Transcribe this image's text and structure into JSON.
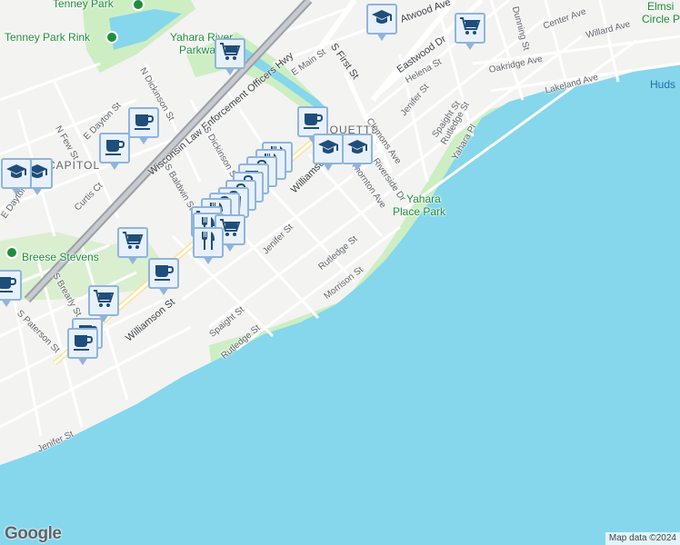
{
  "map": {
    "attribution": "Map data ©2024",
    "logo": "Google",
    "colors": {
      "water": "#86d6ec",
      "park": "#cdeec3",
      "land": "#f3f3f1",
      "highway": "#9aa0a6",
      "marker_fill": "#e8f1fb",
      "marker_border": "#8fb4dc",
      "marker_icon": "#1f4e7a"
    }
  },
  "labels": {
    "parks": {
      "tenney_park": "Tenney Park",
      "tenney_park_rink": "Tenney Park Rink",
      "yahara_river_line1": "Yahara River",
      "yahara_river_line2": "Parkway",
      "yahara_place_line1": "Yahara",
      "yahara_place_line2": "Place Park",
      "breese_stevens": "Breese Stevens"
    },
    "places": {
      "marquette": "MARQUETTE",
      "capitol": "CAPITOL"
    },
    "water": {
      "elmside_line1": "Elmsi",
      "elmside_line2": "Circle P",
      "hudson": "Huds"
    },
    "highways": {
      "wisconsin_law": "Wisconsin Law Enforcement Officers Hwy",
      "williamson": "Williamson St",
      "williamson_2": "Williamson St",
      "e_main": "E Main St"
    },
    "streets": {
      "s_first": "S First St",
      "eastwood": "Eastwood Dr",
      "atwood": "Atwood Ave",
      "center": "Center Ave",
      "willard": "Willard Ave",
      "oakridge": "Oakridge Ave",
      "lakeland": "Lakeland Ave",
      "dunning": "Dunning St",
      "helena": "Helena St",
      "jenifer_ne": "Jenifer St",
      "spaight_ne": "Spaight St",
      "rutledge_ne": "Rutledge St",
      "yahara_pl": "Yahara Pl",
      "clemons": "Clemons Ave",
      "riverside": "Riverside Dr",
      "thornton": "Thornton Ave",
      "n_dickinson": "N Dickinson St",
      "s_dickinson": "S Dickinson St",
      "s_baldwin": "S Baldwin St",
      "e_dayton": "E Dayton St",
      "n_few": "N Few St",
      "curtis": "Curtis Ct",
      "e_dayton_w": "E Dayton St",
      "s_brearly": "S Brearly St",
      "s_paterson": "S Paterson St",
      "jenifer": "Jenifer St",
      "spaight": "Spaight St",
      "rutledge": "Rutledge St",
      "rutledge_2": "Rutledge St",
      "morrison": "Morrison St",
      "jenifer_sw": "Jenifer St"
    }
  },
  "markers": [
    {
      "type": "education",
      "icon": "graduation-cap-icon"
    },
    {
      "type": "grocery",
      "icon": "shopping-cart-icon"
    },
    {
      "type": "grocery",
      "icon": "shopping-cart-icon"
    },
    {
      "type": "cafe",
      "icon": "coffee-cup-icon"
    },
    {
      "type": "cafe",
      "icon": "coffee-cup-icon"
    },
    {
      "type": "cafe",
      "icon": "coffee-cup-icon"
    },
    {
      "type": "education",
      "icon": "graduation-cap-icon"
    },
    {
      "type": "education",
      "icon": "graduation-cap-icon"
    },
    {
      "type": "education",
      "icon": "graduation-cap-icon"
    },
    {
      "type": "education",
      "icon": "graduation-cap-icon"
    },
    {
      "type": "restaurant",
      "icon": "fork-knife-icon"
    },
    {
      "type": "restaurant",
      "icon": "fork-knife-icon"
    },
    {
      "type": "shopping",
      "icon": "shopping-bag-icon"
    },
    {
      "type": "cafe",
      "icon": "coffee-cup-icon"
    },
    {
      "type": "shopping",
      "icon": "shopping-bag-icon"
    },
    {
      "type": "shopping",
      "icon": "shopping-bag-icon"
    },
    {
      "type": "shopping",
      "icon": "shopping-bag-icon"
    },
    {
      "type": "shopping",
      "icon": "shopping-bag-icon"
    },
    {
      "type": "restaurant",
      "icon": "fork-knife-icon"
    },
    {
      "type": "grocery",
      "icon": "shopping-cart-icon"
    },
    {
      "type": "restaurant",
      "icon": "fork-knife-icon"
    },
    {
      "type": "grocery",
      "icon": "shopping-cart-icon"
    },
    {
      "type": "restaurant",
      "icon": "fork-knife-icon"
    },
    {
      "type": "grocery",
      "icon": "shopping-cart-icon"
    },
    {
      "type": "cafe",
      "icon": "coffee-cup-icon"
    },
    {
      "type": "cafe",
      "icon": "coffee-cup-icon"
    },
    {
      "type": "grocery",
      "icon": "shopping-cart-icon"
    },
    {
      "type": "cafe",
      "icon": "coffee-cup-icon"
    },
    {
      "type": "cafe",
      "icon": "coffee-cup-icon"
    }
  ]
}
